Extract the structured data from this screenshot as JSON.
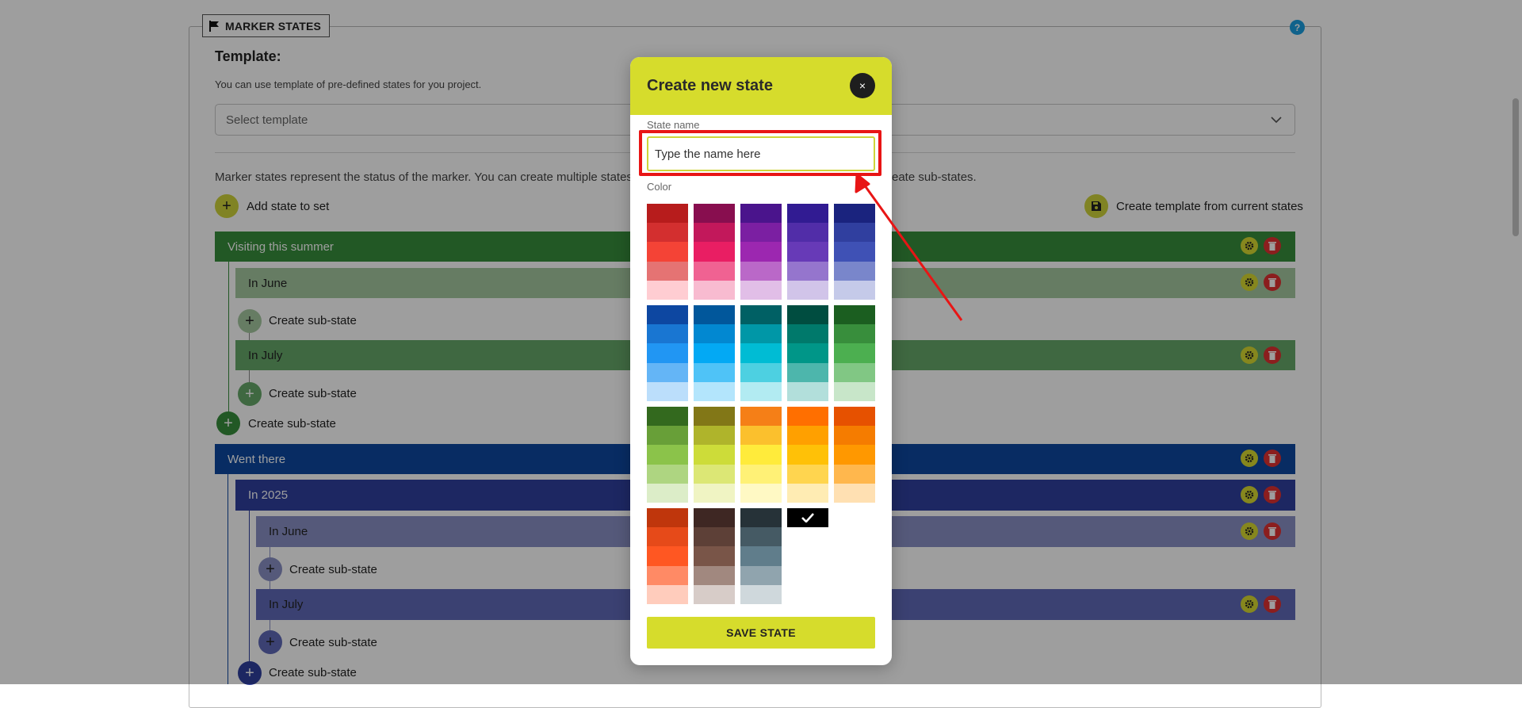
{
  "panel": {
    "legend": "MARKER STATES",
    "help": "?"
  },
  "template": {
    "title": "Template:",
    "description": "You can use template of pre-defined states for you project.",
    "select_placeholder": "Select template"
  },
  "info_text_left": "Marker states represent the status of the marker. You can create multiple states wi",
  "info_text_right": "eate sub-states.",
  "actions": {
    "add_state": "Add state to set",
    "create_template": "Create template from current states"
  },
  "states": [
    {
      "label": "Visiting this summer",
      "children": [
        {
          "label": "In June",
          "sub_label": "Create sub-state"
        },
        {
          "label": "In July",
          "sub_label": "Create sub-state"
        }
      ],
      "sub_label": "Create sub-state"
    },
    {
      "label": "Went there",
      "children": [
        {
          "label": "In 2025",
          "children": [
            {
              "label": "In June",
              "sub_label": "Create sub-state"
            },
            {
              "label": "In July",
              "sub_label": "Create sub-state"
            }
          ],
          "sub_label": "Create sub-state"
        }
      ]
    }
  ],
  "modal": {
    "title": "Create new state",
    "close": "×",
    "state_name_label": "State name",
    "state_name_placeholder": "Type the name here",
    "color_label": "Color",
    "save_label": "SAVE STATE",
    "palette": [
      [
        "#b71c1c",
        "#d32f2f",
        "#f44336",
        "#e57373",
        "#ffcdd2"
      ],
      [
        "#880e4f",
        "#c2185b",
        "#e91e63",
        "#f06292",
        "#f8bbd0"
      ],
      [
        "#4a148c",
        "#7b1fa2",
        "#9c27b0",
        "#ba68c8",
        "#e1bee7"
      ],
      [
        "#311b92",
        "#512da8",
        "#673ab7",
        "#9575cd",
        "#d1c4e9"
      ],
      [
        "#1a237e",
        "#303f9f",
        "#3f51b5",
        "#7986cb",
        "#c5cae9"
      ],
      [
        "#0d47a1",
        "#1976d2",
        "#2196f3",
        "#64b5f6",
        "#bbdefb"
      ],
      [
        "#01579b",
        "#0288d1",
        "#03a9f4",
        "#4fc3f7",
        "#b3e5fc"
      ],
      [
        "#006064",
        "#0097a7",
        "#00bcd4",
        "#4dd0e1",
        "#b2ebf2"
      ],
      [
        "#004d40",
        "#00796b",
        "#009688",
        "#4db6ac",
        "#b2dfdb"
      ],
      [
        "#1b5e20",
        "#388e3c",
        "#4caf50",
        "#81c784",
        "#c8e6c9"
      ],
      [
        "#33691e",
        "#689f38",
        "#8bc34a",
        "#aed581",
        "#dcedc8"
      ],
      [
        "#827717",
        "#afb42b",
        "#cddc39",
        "#dce775",
        "#f0f4c3"
      ],
      [
        "#f57f17",
        "#fbc02d",
        "#ffeb3b",
        "#fff176",
        "#fff9c4"
      ],
      [
        "#ff6f00",
        "#ffa000",
        "#ffc107",
        "#ffd54f",
        "#ffecb3"
      ],
      [
        "#e65100",
        "#f57c00",
        "#ff9800",
        "#ffb74d",
        "#ffe0b2"
      ],
      [
        "#bf360c",
        "#e64a19",
        "#ff5722",
        "#ff8a65",
        "#ffccbc"
      ],
      [
        "#3e2723",
        "#5d4037",
        "#795548",
        "#a1887f",
        "#d7ccc8"
      ],
      [
        "#263238",
        "#455a64",
        "#607d8b",
        "#90a4ae",
        "#cfd8dc"
      ]
    ],
    "selected_color": "#000000",
    "selected_icon": "check-icon"
  },
  "colors": {
    "accent": "#d6dc2c",
    "danger": "#e03131",
    "visiting": "#388e3c",
    "june_green": "#a5c8a1",
    "july_green": "#66a86a",
    "went_there": "#0d47a1",
    "in_2025": "#303f9f",
    "june_purple": "#8a90c6",
    "july_purple": "#5f69b8",
    "annotation": "#e81515"
  }
}
